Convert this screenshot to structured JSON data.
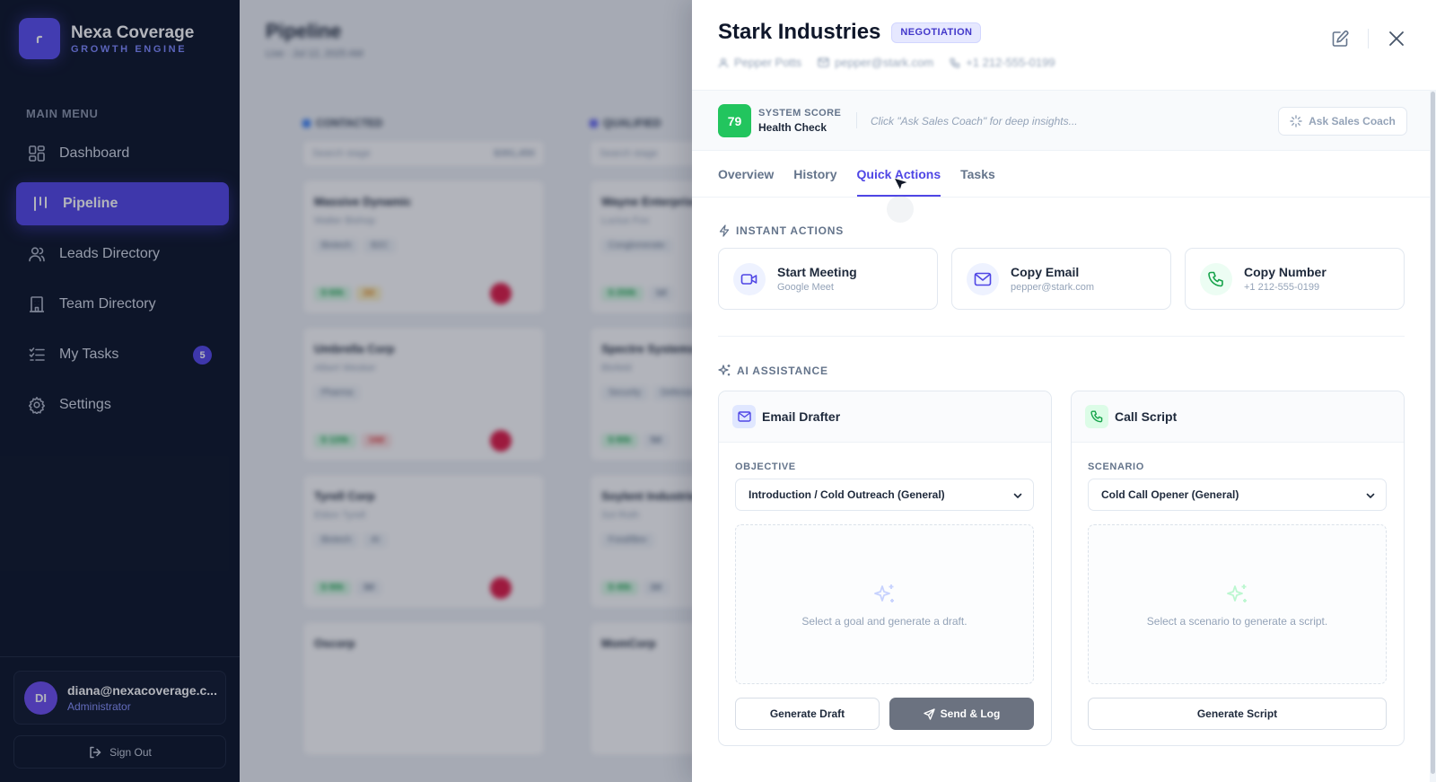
{
  "app": {
    "name": "Nexa Coverage",
    "tagline": "GROWTH ENGINE"
  },
  "sidebar": {
    "menu_label": "MAIN MENU",
    "items": [
      {
        "label": "Dashboard",
        "icon": "dashboard-icon"
      },
      {
        "label": "Pipeline",
        "icon": "pipeline-icon",
        "active": true
      },
      {
        "label": "Leads Directory",
        "icon": "users-icon"
      },
      {
        "label": "Team Directory",
        "icon": "building-icon"
      },
      {
        "label": "My Tasks",
        "icon": "tasks-icon",
        "badge": "5"
      },
      {
        "label": "Settings",
        "icon": "gear-icon"
      }
    ],
    "user": {
      "initials": "DI",
      "email": "diana@nexacoverage.c...",
      "role": "Administrator"
    },
    "sign_out": "Sign Out"
  },
  "pipeline_bg": {
    "title": "Pipeline",
    "subtitle": "Live · Jul 12, 2025 AM",
    "columns": [
      {
        "name": "CONTACTED",
        "color": "#3b82f6",
        "input": "Search stage",
        "total": "$391,450",
        "cards": [
          {
            "name": "Massive Dynamic",
            "sub": "Walter Bishop",
            "tags": [
              "Biotech",
              "B2C"
            ],
            "stats": [
              "$ 60k",
              "2d"
            ]
          },
          {
            "name": "Umbrella Corp",
            "sub": "Albert Wesker",
            "tags": [
              "Pharma"
            ],
            "stats": [
              "$ 120k",
              "14d"
            ]
          },
          {
            "name": "Tyrell Corp",
            "sub": "Eldon Tyrell",
            "tags": [
              "Biotech",
              "AI"
            ],
            "stats": [
              "$ 90k",
              "3d"
            ]
          }
        ]
      },
      {
        "name": "QUALIFIED",
        "color": "#6366f1",
        "input": "Search stage",
        "total": "",
        "cards": [
          {
            "name": "Wayne Enterprises",
            "sub": "Lucius Fox",
            "tags": [
              "Conglomerate"
            ],
            "stats": [
              "$ 250k",
              "1d"
            ]
          },
          {
            "name": "Spectre Systems",
            "sub": "Blofeld",
            "tags": [
              "Security",
              "Defense"
            ],
            "stats": [
              "$ 80k",
              "5d"
            ]
          },
          {
            "name": "Soylent Industries",
            "sub": "Sol Roth",
            "tags": [
              "Food/Bev"
            ],
            "stats": [
              "$ 40k",
              "2d"
            ]
          }
        ]
      }
    ],
    "bottom_cards": [
      "Oscorp",
      "MomCorp"
    ]
  },
  "deal": {
    "company": "Stark Industries",
    "stage": "NEGOTIATION",
    "contact_name": "Pepper Potts",
    "contact_email": "pepper@stark.com",
    "contact_phone": "+1 212-555-0199"
  },
  "score": {
    "value": "79",
    "label": "SYSTEM SCORE",
    "health": "Health Check",
    "hint": "Click \"Ask Sales Coach\" for deep insights...",
    "coach_button": "Ask Sales Coach"
  },
  "tabs": [
    {
      "label": "Overview"
    },
    {
      "label": "History"
    },
    {
      "label": "Quick Actions",
      "active": true
    },
    {
      "label": "Tasks"
    }
  ],
  "instant_actions": {
    "title": "INSTANT ACTIONS",
    "items": [
      {
        "title": "Start Meeting",
        "sub": "Google Meet",
        "icon": "video-icon"
      },
      {
        "title": "Copy Email",
        "sub": "pepper@stark.com",
        "icon": "mail-icon"
      },
      {
        "title": "Copy Number",
        "sub": "+1 212-555-0199",
        "icon": "phone-icon"
      }
    ]
  },
  "ai": {
    "title": "AI ASSISTANCE",
    "email_drafter": {
      "title": "Email Drafter",
      "field_label": "OBJECTIVE",
      "selected": "Introduction / Cold Outreach (General)",
      "placeholder": "Select a goal and generate a draft.",
      "generate": "Generate Draft",
      "send": "Send & Log"
    },
    "call_script": {
      "title": "Call Script",
      "field_label": "SCENARIO",
      "selected": "Cold Call Opener (General)",
      "placeholder": "Select a scenario to generate a script.",
      "generate": "Generate Script"
    }
  },
  "colors": {
    "accent": "#5447e8",
    "score_green": "#22c55e",
    "sidebar_bg": "#0d1528"
  }
}
